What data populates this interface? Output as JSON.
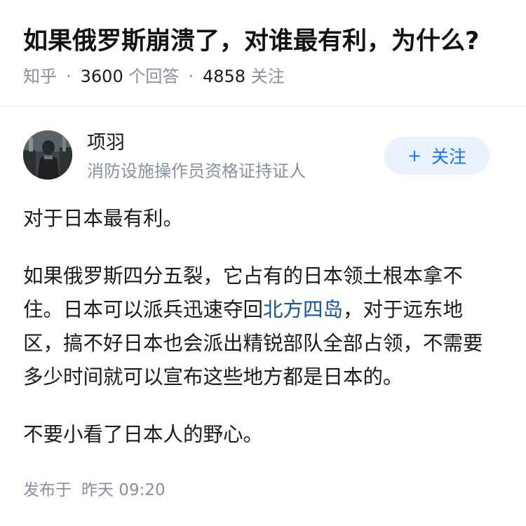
{
  "question": {
    "title": "如果俄罗斯崩溃了，对谁最有利，为什么?",
    "source": "知乎",
    "separator": "·",
    "answer_count": "3600",
    "answer_unit": "个回答",
    "follow_count": "4858",
    "follow_unit": "关注"
  },
  "answer": {
    "author": {
      "name": "项羽",
      "bio": "消防设施操作员资格证持证人",
      "avatar_icon": "avatar-photo"
    },
    "follow_button": {
      "icon": "plus",
      "plus_glyph": "+",
      "label": "关注"
    },
    "content": {
      "p1": "对于日本最有利。",
      "p2_before": "如果俄罗斯四分五裂，它占有的日本领土根本拿不住。日本可以派兵迅速夺回",
      "p2_link": "北方四岛",
      "p2_after": "，对于远东地区，搞不好日本也会派出精锐部队全部占领，不需要多少时间就可以宣布这些地方都是日本的。",
      "p3": "不要小看了日本人的野心。"
    },
    "publish": {
      "label": "发布于",
      "time": "昨天 09:20"
    }
  },
  "colors": {
    "link": "#175199",
    "follow_text": "#1772f6",
    "follow_bg": "#e8f1fc",
    "meta_gray": "#8590a6"
  }
}
